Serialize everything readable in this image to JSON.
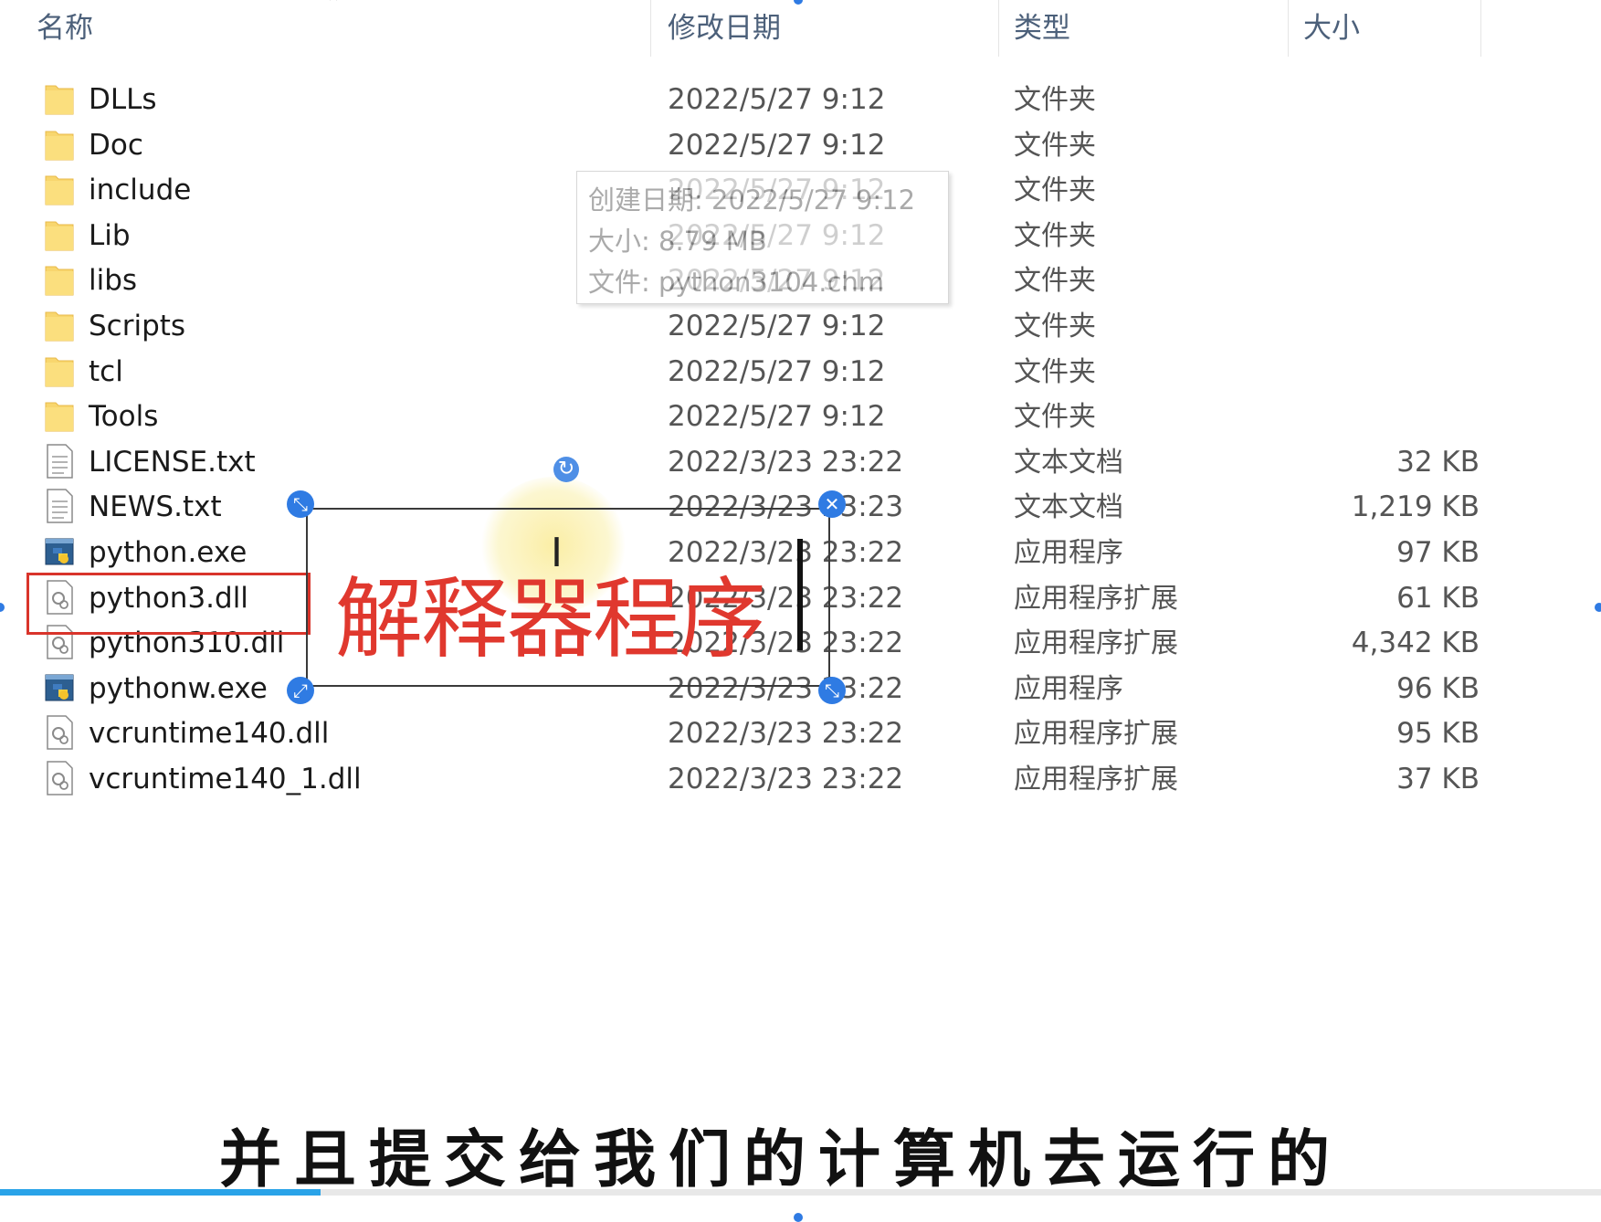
{
  "columns": {
    "name": "名称",
    "modified": "修改日期",
    "type": "类型",
    "size": "大小"
  },
  "files": [
    {
      "name": "DLLs",
      "date": "2022/5/27 9:12",
      "type": "文件夹",
      "size": "",
      "icon": "folder-icon"
    },
    {
      "name": "Doc",
      "date": "2022/5/27 9:12",
      "type": "文件夹",
      "size": "",
      "icon": "folder-icon"
    },
    {
      "name": "include",
      "date": "2022/5/27 9:12",
      "type": "文件夹",
      "size": "",
      "icon": "folder-icon"
    },
    {
      "name": "Lib",
      "date": "2022/5/27 9:12",
      "type": "文件夹",
      "size": "",
      "icon": "folder-icon"
    },
    {
      "name": "libs",
      "date": "2022/5/27 9:12",
      "type": "文件夹",
      "size": "",
      "icon": "folder-icon"
    },
    {
      "name": "Scripts",
      "date": "2022/5/27 9:12",
      "type": "文件夹",
      "size": "",
      "icon": "folder-icon"
    },
    {
      "name": "tcl",
      "date": "2022/5/27 9:12",
      "type": "文件夹",
      "size": "",
      "icon": "folder-icon"
    },
    {
      "name": "Tools",
      "date": "2022/5/27 9:12",
      "type": "文件夹",
      "size": "",
      "icon": "folder-icon"
    },
    {
      "name": "LICENSE.txt",
      "date": "2022/3/23 23:22",
      "type": "文本文档",
      "size": "32 KB",
      "icon": "text-file-icon"
    },
    {
      "name": "NEWS.txt",
      "date": "2022/3/23 23:23",
      "type": "文本文档",
      "size": "1,219 KB",
      "icon": "text-file-icon"
    },
    {
      "name": "python.exe",
      "date": "2022/3/23 23:22",
      "type": "应用程序",
      "size": "97 KB",
      "icon": "python-exe-icon"
    },
    {
      "name": "python3.dll",
      "date": "2022/3/23 23:22",
      "type": "应用程序扩展",
      "size": "61 KB",
      "icon": "dll-file-icon"
    },
    {
      "name": "python310.dll",
      "date": "2022/3/23 23:22",
      "type": "应用程序扩展",
      "size": "4,342 KB",
      "icon": "dll-file-icon"
    },
    {
      "name": "pythonw.exe",
      "date": "2022/3/23 23:22",
      "type": "应用程序",
      "size": "96 KB",
      "icon": "python-exe-icon"
    },
    {
      "name": "vcruntime140.dll",
      "date": "2022/3/23 23:22",
      "type": "应用程序扩展",
      "size": "95 KB",
      "icon": "dll-file-icon"
    },
    {
      "name": "vcruntime140_1.dll",
      "date": "2022/3/23 23:22",
      "type": "应用程序扩展",
      "size": "37 KB",
      "icon": "dll-file-icon"
    }
  ],
  "tooltip": {
    "created": "创建日期: 2022/5/27 9:12",
    "size": "大小: 8.79 MB",
    "file": "文件: python3104.chm"
  },
  "annotation": {
    "label": "解释器程序",
    "color": "#e0382e"
  },
  "caption": "并且提交给我们的计算机去运行的",
  "video_progress": 0.2,
  "colors": {
    "folder": "#f8d66e",
    "highlight": "#d9342b",
    "handle": "#2f7be3",
    "progress": "#29a3e8"
  }
}
